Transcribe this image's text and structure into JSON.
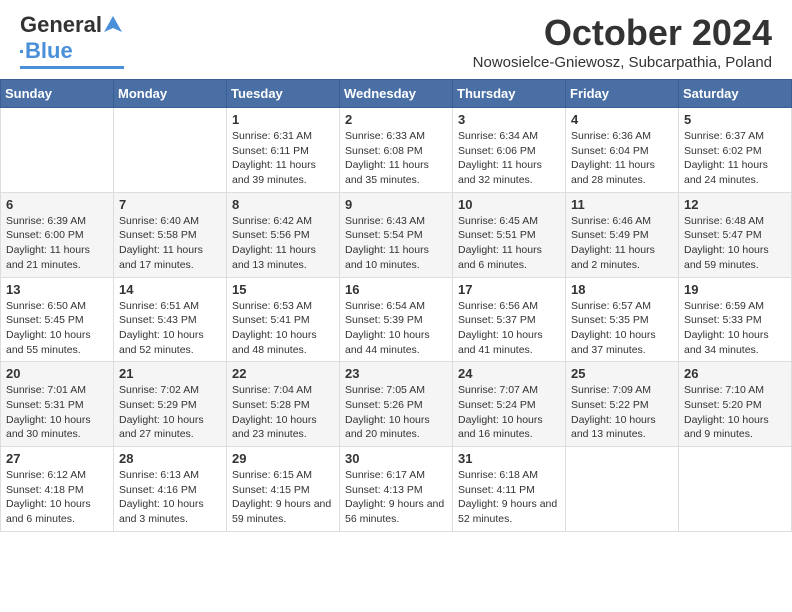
{
  "header": {
    "logo_general": "General",
    "logo_blue": "Blue",
    "title": "October 2024",
    "subtitle": "Nowosielce-Gniewosz, Subcarpathia, Poland"
  },
  "days_of_week": [
    "Sunday",
    "Monday",
    "Tuesday",
    "Wednesday",
    "Thursday",
    "Friday",
    "Saturday"
  ],
  "weeks": [
    [
      {
        "day": "",
        "info": ""
      },
      {
        "day": "",
        "info": ""
      },
      {
        "day": "1",
        "info": "Sunrise: 6:31 AM\nSunset: 6:11 PM\nDaylight: 11 hours and 39 minutes."
      },
      {
        "day": "2",
        "info": "Sunrise: 6:33 AM\nSunset: 6:08 PM\nDaylight: 11 hours and 35 minutes."
      },
      {
        "day": "3",
        "info": "Sunrise: 6:34 AM\nSunset: 6:06 PM\nDaylight: 11 hours and 32 minutes."
      },
      {
        "day": "4",
        "info": "Sunrise: 6:36 AM\nSunset: 6:04 PM\nDaylight: 11 hours and 28 minutes."
      },
      {
        "day": "5",
        "info": "Sunrise: 6:37 AM\nSunset: 6:02 PM\nDaylight: 11 hours and 24 minutes."
      }
    ],
    [
      {
        "day": "6",
        "info": "Sunrise: 6:39 AM\nSunset: 6:00 PM\nDaylight: 11 hours and 21 minutes."
      },
      {
        "day": "7",
        "info": "Sunrise: 6:40 AM\nSunset: 5:58 PM\nDaylight: 11 hours and 17 minutes."
      },
      {
        "day": "8",
        "info": "Sunrise: 6:42 AM\nSunset: 5:56 PM\nDaylight: 11 hours and 13 minutes."
      },
      {
        "day": "9",
        "info": "Sunrise: 6:43 AM\nSunset: 5:54 PM\nDaylight: 11 hours and 10 minutes."
      },
      {
        "day": "10",
        "info": "Sunrise: 6:45 AM\nSunset: 5:51 PM\nDaylight: 11 hours and 6 minutes."
      },
      {
        "day": "11",
        "info": "Sunrise: 6:46 AM\nSunset: 5:49 PM\nDaylight: 11 hours and 2 minutes."
      },
      {
        "day": "12",
        "info": "Sunrise: 6:48 AM\nSunset: 5:47 PM\nDaylight: 10 hours and 59 minutes."
      }
    ],
    [
      {
        "day": "13",
        "info": "Sunrise: 6:50 AM\nSunset: 5:45 PM\nDaylight: 10 hours and 55 minutes."
      },
      {
        "day": "14",
        "info": "Sunrise: 6:51 AM\nSunset: 5:43 PM\nDaylight: 10 hours and 52 minutes."
      },
      {
        "day": "15",
        "info": "Sunrise: 6:53 AM\nSunset: 5:41 PM\nDaylight: 10 hours and 48 minutes."
      },
      {
        "day": "16",
        "info": "Sunrise: 6:54 AM\nSunset: 5:39 PM\nDaylight: 10 hours and 44 minutes."
      },
      {
        "day": "17",
        "info": "Sunrise: 6:56 AM\nSunset: 5:37 PM\nDaylight: 10 hours and 41 minutes."
      },
      {
        "day": "18",
        "info": "Sunrise: 6:57 AM\nSunset: 5:35 PM\nDaylight: 10 hours and 37 minutes."
      },
      {
        "day": "19",
        "info": "Sunrise: 6:59 AM\nSunset: 5:33 PM\nDaylight: 10 hours and 34 minutes."
      }
    ],
    [
      {
        "day": "20",
        "info": "Sunrise: 7:01 AM\nSunset: 5:31 PM\nDaylight: 10 hours and 30 minutes."
      },
      {
        "day": "21",
        "info": "Sunrise: 7:02 AM\nSunset: 5:29 PM\nDaylight: 10 hours and 27 minutes."
      },
      {
        "day": "22",
        "info": "Sunrise: 7:04 AM\nSunset: 5:28 PM\nDaylight: 10 hours and 23 minutes."
      },
      {
        "day": "23",
        "info": "Sunrise: 7:05 AM\nSunset: 5:26 PM\nDaylight: 10 hours and 20 minutes."
      },
      {
        "day": "24",
        "info": "Sunrise: 7:07 AM\nSunset: 5:24 PM\nDaylight: 10 hours and 16 minutes."
      },
      {
        "day": "25",
        "info": "Sunrise: 7:09 AM\nSunset: 5:22 PM\nDaylight: 10 hours and 13 minutes."
      },
      {
        "day": "26",
        "info": "Sunrise: 7:10 AM\nSunset: 5:20 PM\nDaylight: 10 hours and 9 minutes."
      }
    ],
    [
      {
        "day": "27",
        "info": "Sunrise: 6:12 AM\nSunset: 4:18 PM\nDaylight: 10 hours and 6 minutes."
      },
      {
        "day": "28",
        "info": "Sunrise: 6:13 AM\nSunset: 4:16 PM\nDaylight: 10 hours and 3 minutes."
      },
      {
        "day": "29",
        "info": "Sunrise: 6:15 AM\nSunset: 4:15 PM\nDaylight: 9 hours and 59 minutes."
      },
      {
        "day": "30",
        "info": "Sunrise: 6:17 AM\nSunset: 4:13 PM\nDaylight: 9 hours and 56 minutes."
      },
      {
        "day": "31",
        "info": "Sunrise: 6:18 AM\nSunset: 4:11 PM\nDaylight: 9 hours and 52 minutes."
      },
      {
        "day": "",
        "info": ""
      },
      {
        "day": "",
        "info": ""
      }
    ]
  ]
}
